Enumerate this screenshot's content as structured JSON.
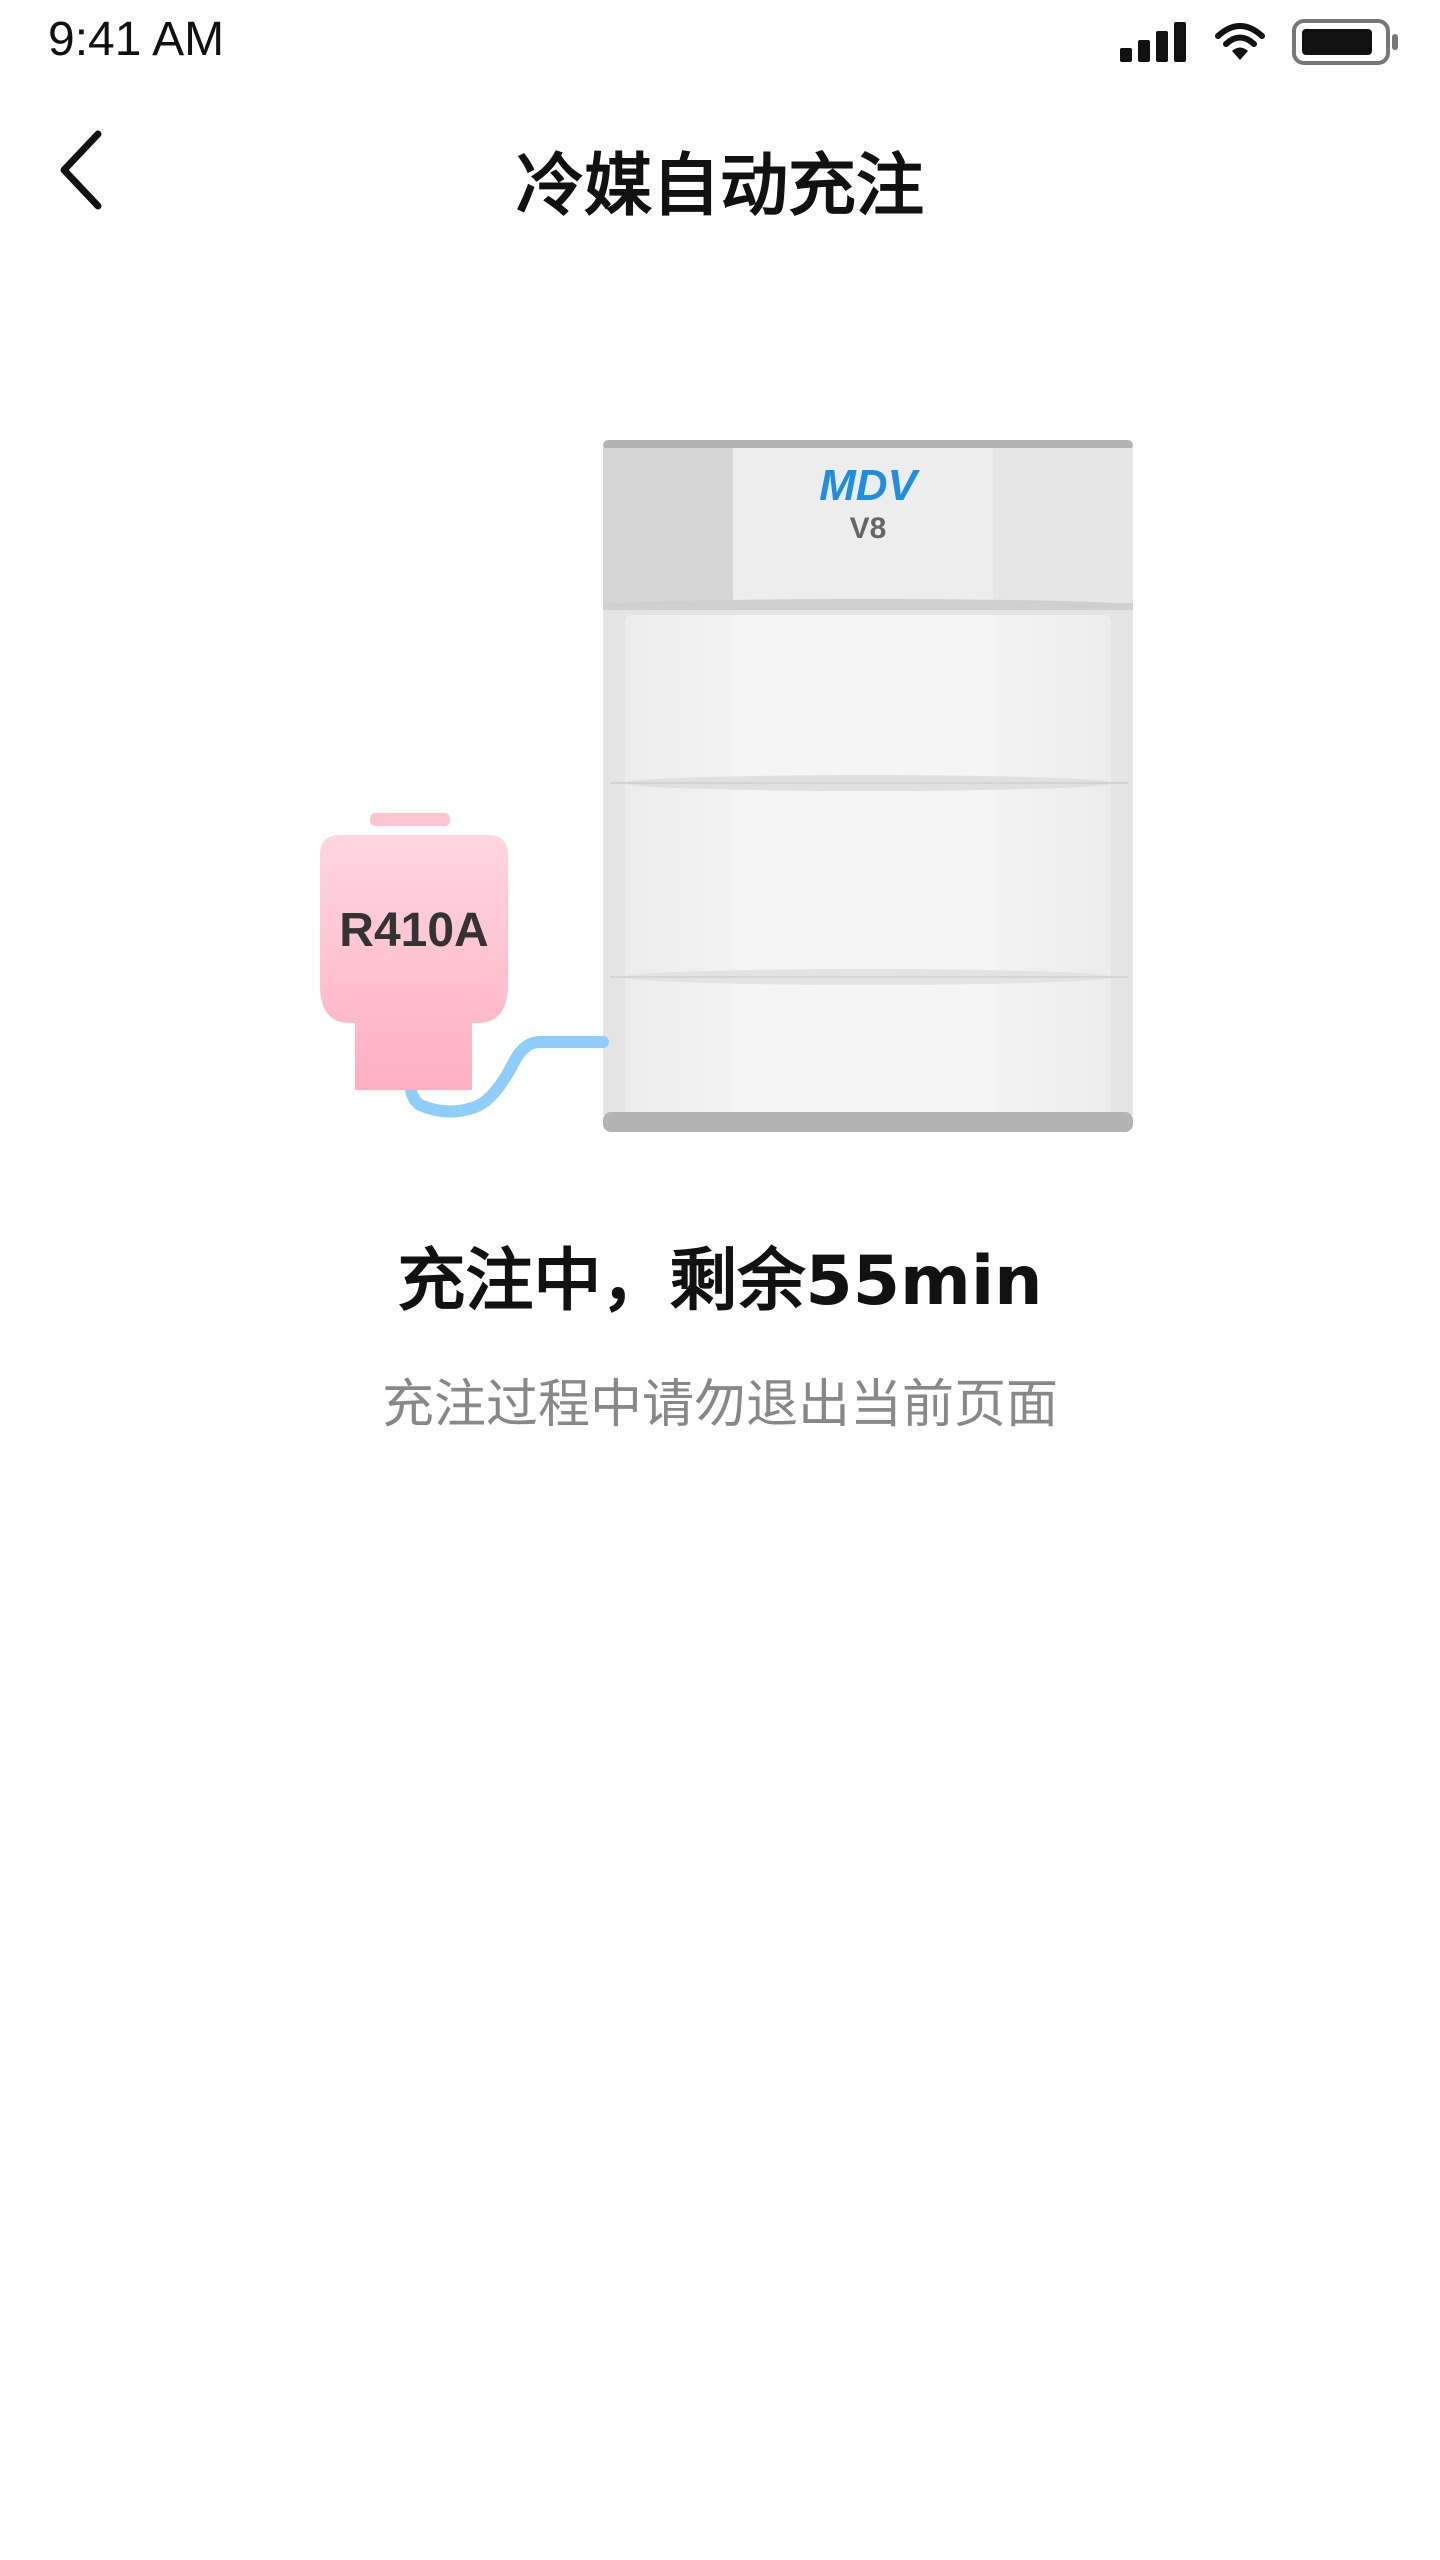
{
  "status_bar": {
    "time": "9:41 AM"
  },
  "header": {
    "back_icon": "chevron-left-icon",
    "title": "冷媒自动充注"
  },
  "illustration": {
    "tank_label": "R410A",
    "unit_brand_top": "MDV",
    "unit_brand_bottom": "V8",
    "colors": {
      "tank": "#ffb5c8",
      "hose": "#8fcdfb",
      "brand_blue": "#1f8ee0",
      "unit_gray": "#e2e2e2"
    }
  },
  "progress": {
    "status_text": "充注中，剩余55min",
    "hint_text": "充注过程中请勿退出当前页面"
  }
}
